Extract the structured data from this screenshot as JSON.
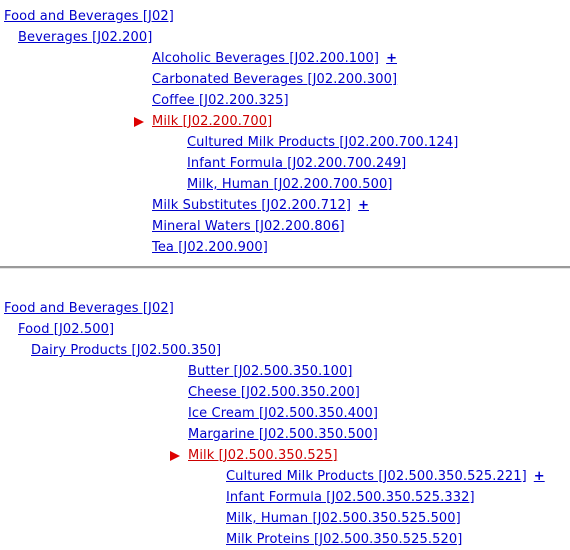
{
  "page": {
    "title": "MeSH Tree Hierarchy - Milk",
    "link_color": "#0000cc",
    "current_color": "#cc0000",
    "marker_color": "#dd0000",
    "divider_color": "#9a9a9a",
    "background": "#ffffff"
  },
  "icons": {
    "marker": "current-node-arrow-icon",
    "expander": "+"
  },
  "blocks": [
    {
      "id": "block-1",
      "rows": [
        {
          "indent": 4,
          "label": "Food and Beverages [J02]",
          "current": false,
          "marker": false,
          "expander": false
        },
        {
          "indent": 18,
          "label": "Beverages [J02.200]",
          "current": false,
          "marker": false,
          "expander": false
        },
        {
          "indent": 152,
          "label": "Alcoholic Beverages [J02.200.100]",
          "current": false,
          "marker": false,
          "expander": true
        },
        {
          "indent": 152,
          "label": "Carbonated Beverages [J02.200.300]",
          "current": false,
          "marker": false,
          "expander": false
        },
        {
          "indent": 152,
          "label": "Coffee [J02.200.325]",
          "current": false,
          "marker": false,
          "expander": false
        },
        {
          "indent": 152,
          "label": "Milk [J02.200.700]",
          "current": true,
          "marker": true,
          "expander": false
        },
        {
          "indent": 187,
          "label": "Cultured Milk Products [J02.200.700.124]",
          "current": false,
          "marker": false,
          "expander": false
        },
        {
          "indent": 187,
          "label": "Infant Formula [J02.200.700.249]",
          "current": false,
          "marker": false,
          "expander": false
        },
        {
          "indent": 187,
          "label": "Milk, Human [J02.200.700.500]",
          "current": false,
          "marker": false,
          "expander": false
        },
        {
          "indent": 152,
          "label": "Milk Substitutes [J02.200.712]",
          "current": false,
          "marker": false,
          "expander": true
        },
        {
          "indent": 152,
          "label": "Mineral Waters [J02.200.806]",
          "current": false,
          "marker": false,
          "expander": false
        },
        {
          "indent": 152,
          "label": "Tea [J02.200.900]",
          "current": false,
          "marker": false,
          "expander": false
        }
      ]
    },
    {
      "id": "block-2",
      "rows": [
        {
          "indent": 4,
          "label": "Food and Beverages [J02]",
          "current": false,
          "marker": false,
          "expander": false
        },
        {
          "indent": 18,
          "label": "Food [J02.500]",
          "current": false,
          "marker": false,
          "expander": false
        },
        {
          "indent": 31,
          "label": "Dairy Products [J02.500.350]",
          "current": false,
          "marker": false,
          "expander": false
        },
        {
          "indent": 188,
          "label": "Butter [J02.500.350.100]",
          "current": false,
          "marker": false,
          "expander": false
        },
        {
          "indent": 188,
          "label": "Cheese [J02.500.350.200]",
          "current": false,
          "marker": false,
          "expander": false
        },
        {
          "indent": 188,
          "label": "Ice Cream [J02.500.350.400]",
          "current": false,
          "marker": false,
          "expander": false
        },
        {
          "indent": 188,
          "label": "Margarine [J02.500.350.500]",
          "current": false,
          "marker": false,
          "expander": false
        },
        {
          "indent": 188,
          "label": "Milk [J02.500.350.525]",
          "current": true,
          "marker": true,
          "expander": false
        },
        {
          "indent": 226,
          "label": "Cultured Milk Products [J02.500.350.525.221]",
          "current": false,
          "marker": false,
          "expander": true
        },
        {
          "indent": 226,
          "label": "Infant Formula [J02.500.350.525.332]",
          "current": false,
          "marker": false,
          "expander": false
        },
        {
          "indent": 226,
          "label": "Milk, Human [J02.500.350.525.500]",
          "current": false,
          "marker": false,
          "expander": false
        },
        {
          "indent": 226,
          "label": "Milk Proteins [J02.500.350.525.520]",
          "current": false,
          "marker": false,
          "expander": false
        }
      ]
    }
  ]
}
